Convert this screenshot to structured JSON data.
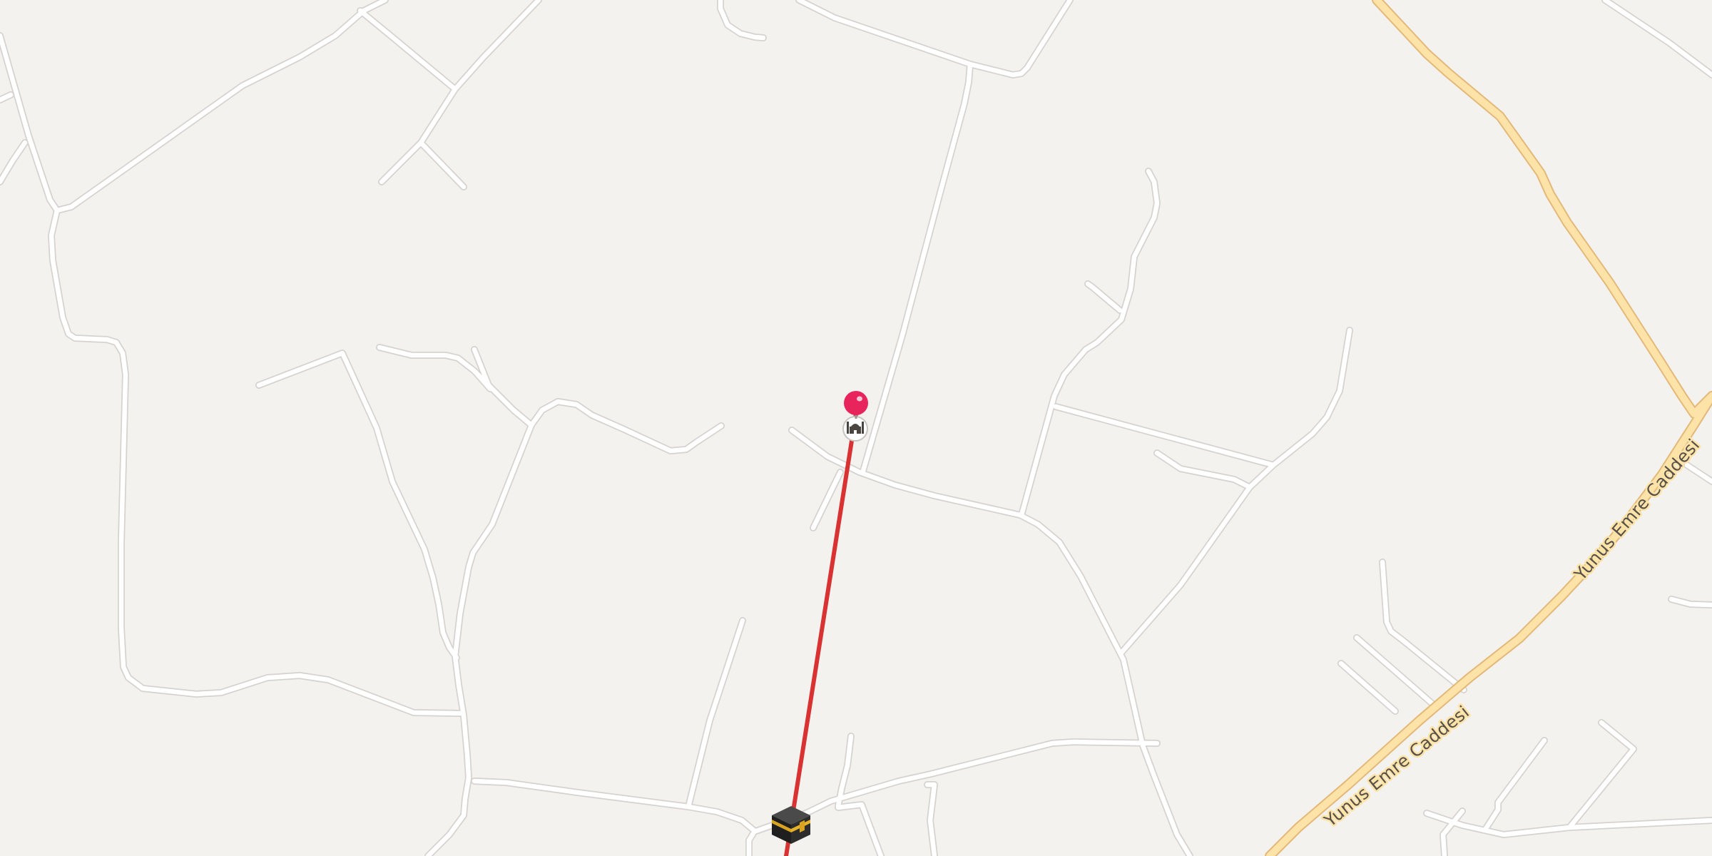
{
  "map": {
    "streets": [
      {
        "name": "Yunus Emre Caddesi"
      },
      {
        "name": "Yunus Emre Caddesi"
      }
    ],
    "markers": {
      "pin": {
        "icon": "map-pin-icon",
        "color": "#e8245c"
      },
      "mosque": {
        "icon": "mosque-icon"
      },
      "kaaba": {
        "icon": "kaaba-icon"
      }
    },
    "qibla_line": {
      "color": "#d93232"
    },
    "colors": {
      "background": "#f4f2ef",
      "road": "#ffffff",
      "major_road": "#fde3a7"
    }
  }
}
